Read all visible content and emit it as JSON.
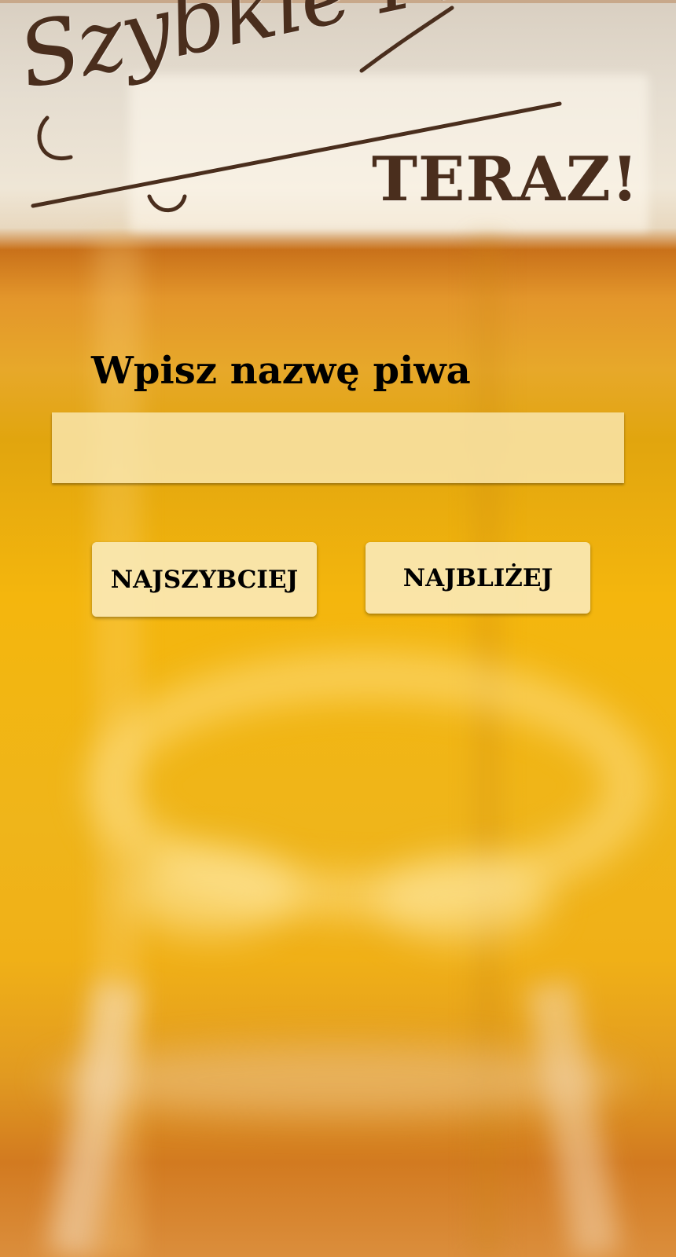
{
  "logo": {
    "script_text": "Szybkie Piwo",
    "teraz_text": "TERAZ!"
  },
  "search": {
    "label": "Wpisz nazwę piwa",
    "value": "",
    "placeholder": ""
  },
  "buttons": {
    "fastest_label": "NAJSZYBCIEJ",
    "nearest_label": "NAJBLIŻEJ"
  },
  "colors": {
    "logo_brown": "#4a2e1d",
    "beer_amber": "#f4b60d",
    "field_cream": "#fae8b2"
  }
}
